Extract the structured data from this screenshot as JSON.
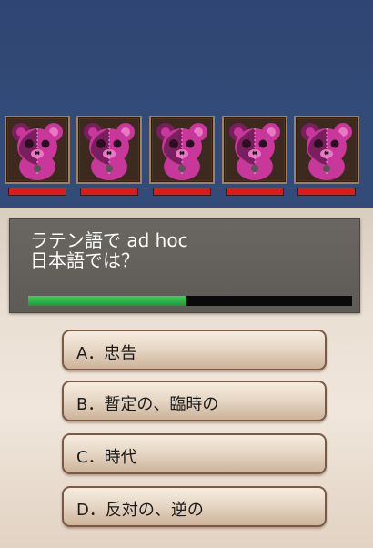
{
  "question": {
    "line1": "ラテン語で ad hoc",
    "line2": "日本語では？"
  },
  "timer": {
    "remaining_fraction": 0.49
  },
  "enemies": [
    {
      "icon": "pink-teddy-bear-icon",
      "hp_fraction": 1.0
    },
    {
      "icon": "pink-teddy-bear-icon",
      "hp_fraction": 1.0
    },
    {
      "icon": "pink-teddy-bear-icon",
      "hp_fraction": 1.0
    },
    {
      "icon": "pink-teddy-bear-icon",
      "hp_fraction": 1.0
    },
    {
      "icon": "pink-teddy-bear-icon",
      "hp_fraction": 1.0
    }
  ],
  "answers": [
    {
      "label": "A．忠告"
    },
    {
      "label": "B．暫定の、臨時の"
    },
    {
      "label": "C．時代"
    },
    {
      "label": "D．反対の、逆の"
    }
  ],
  "colors": {
    "sky": "#334b78",
    "hp_bar": "#e3181b",
    "timer_bar": "#2fbb4a",
    "bear_pink": "#c9379a",
    "bear_dark": "#7a1f5e"
  }
}
